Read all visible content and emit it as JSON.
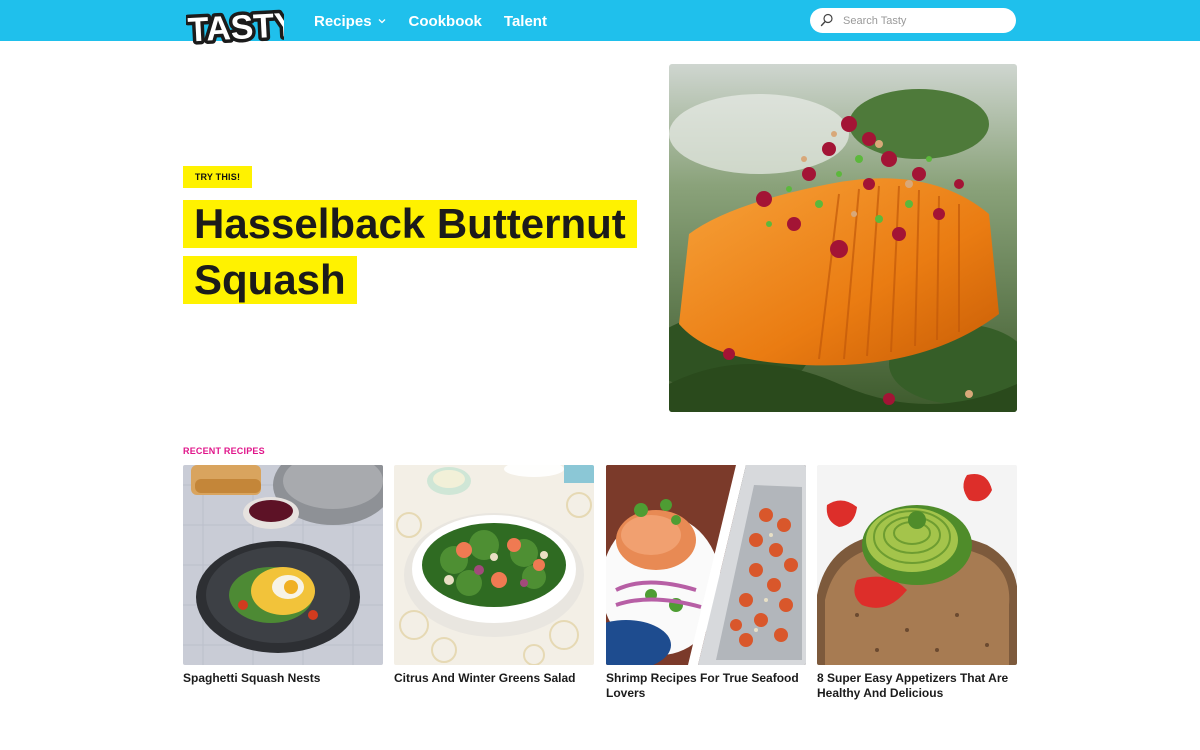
{
  "header": {
    "logo_text": "TASTY",
    "nav": [
      {
        "label": "Recipes",
        "has_dropdown": true
      },
      {
        "label": "Cookbook"
      },
      {
        "label": "Talent"
      }
    ],
    "search": {
      "placeholder": "Search Tasty",
      "value": ""
    }
  },
  "hero": {
    "tag": "TRY THIS!",
    "title_line1": "Hasselback Butternut",
    "title_line2": "Squash"
  },
  "recent": {
    "label": "RECENT RECIPES",
    "cards": [
      {
        "title": "Spaghetti Squash Nests"
      },
      {
        "title": "Citrus And Winter Greens Salad"
      },
      {
        "title": "Shrimp Recipes For True Seafood Lovers"
      },
      {
        "title": "8 Super Easy Appetizers That Are Healthy And Delicious"
      }
    ]
  },
  "colors": {
    "brand_blue": "#1fc0ec",
    "highlight_yellow": "#fff200",
    "section_pink": "#e0158a"
  },
  "icons": [
    "tasty-logo",
    "chevron-down-icon",
    "search-icon"
  ]
}
